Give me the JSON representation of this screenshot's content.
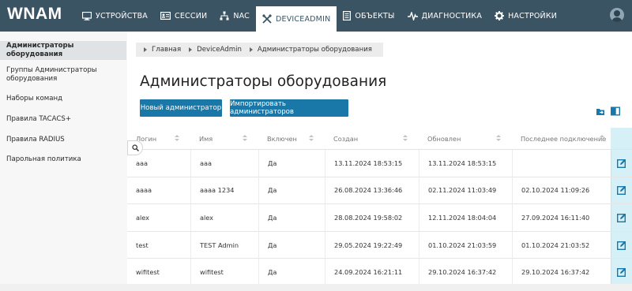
{
  "app": {
    "logo": "WNAM"
  },
  "nav": [
    {
      "id": "devices",
      "label": "Устройства",
      "icon": "monitor-icon",
      "active": false
    },
    {
      "id": "sessions",
      "label": "Сессии",
      "icon": "id-card-icon",
      "active": false
    },
    {
      "id": "nac",
      "label": "NAC",
      "icon": "network-icon",
      "active": false
    },
    {
      "id": "deviceadmin",
      "label": "DeviceAdmin",
      "icon": "tools-icon",
      "active": true
    },
    {
      "id": "objects",
      "label": "Объекты",
      "icon": "document-icon",
      "active": false
    },
    {
      "id": "diagnostics",
      "label": "Диагностика",
      "icon": "pulse-icon",
      "active": false
    },
    {
      "id": "settings",
      "label": "Настройки",
      "icon": "gear-icon",
      "active": false
    }
  ],
  "sidebar": {
    "items": [
      {
        "label": "Администраторы оборудования",
        "active": true
      },
      {
        "label": "Группы Администраторы оборудования",
        "active": false
      },
      {
        "label": "Наборы команд",
        "active": false
      },
      {
        "label": "Правила TACACS+",
        "active": false
      },
      {
        "label": "Правила RADIUS",
        "active": false
      },
      {
        "label": "Парольная политика",
        "active": false
      }
    ]
  },
  "breadcrumb": [
    "Главная",
    "DeviceAdmin",
    "Администраторы оборудования"
  ],
  "page": {
    "title": "Администраторы оборудования",
    "new_button": "Новый администратор",
    "import_button": "Импортировать администраторов"
  },
  "table": {
    "columns": [
      "Логин",
      "Имя",
      "Включен",
      "Создан",
      "Обновлен",
      "Последнее подключение"
    ],
    "rows": [
      [
        "aaa",
        "aaa",
        "Да",
        "13.11.2024 18:53:15",
        "13.11.2024 18:53:15",
        ""
      ],
      [
        "aaaa",
        "aaaa 1234",
        "Да",
        "26.08.2024 13:36:46",
        "02.11.2024 11:03:49",
        "02.10.2024 11:09:26"
      ],
      [
        "alex",
        "alex",
        "Да",
        "28.08.2024 19:58:02",
        "12.11.2024 18:04:04",
        "27.09.2024 16:11:40"
      ],
      [
        "test",
        "TEST Admin",
        "Да",
        "29.05.2024 19:22:49",
        "01.10.2024 21:03:59",
        "01.10.2024 21:03:52"
      ],
      [
        "wifitest",
        "wifitest",
        "Да",
        "24.09.2024 16:21:11",
        "29.10.2024 16:37:42",
        "29.10.2024 16:37:42"
      ]
    ]
  },
  "colors": {
    "topbar": "#3b5464",
    "accent": "#1a78a8",
    "edit_cell": "#d6f0f7"
  }
}
